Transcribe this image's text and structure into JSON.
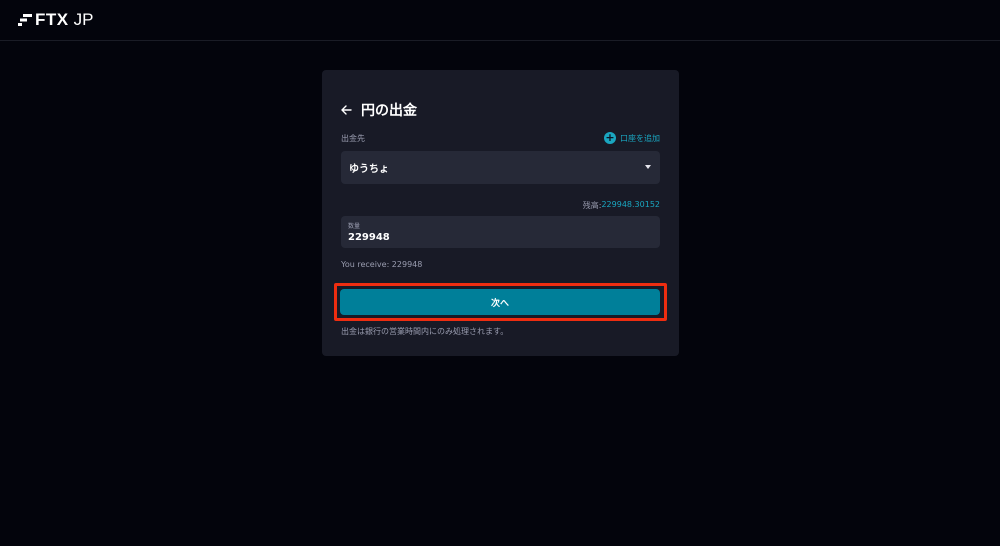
{
  "header": {
    "logo_brand": "FTX",
    "logo_region": "JP"
  },
  "withdraw": {
    "title": "円の出金",
    "destination_label": "出金先",
    "add_account_label": "口座を追加",
    "selected_account": "ゆうちょ",
    "balance_label": "残高:",
    "balance_value": "229948.30152",
    "amount_label": "数量",
    "amount_value": "229948",
    "receive_text": "You receive: 229948",
    "next_label": "次へ",
    "note": "出金は銀行の営業時間内にのみ処理されます。"
  },
  "colors": {
    "accent": "#1aa6c0",
    "button": "#007f99",
    "highlight": "#ee2d10",
    "card": "#181a26",
    "background": "#03040c"
  },
  "icons": {
    "logo": "ftx-logo-icon",
    "back": "back-arrow-icon",
    "add": "plus-circle-icon",
    "dropdown": "caret-down-icon"
  }
}
